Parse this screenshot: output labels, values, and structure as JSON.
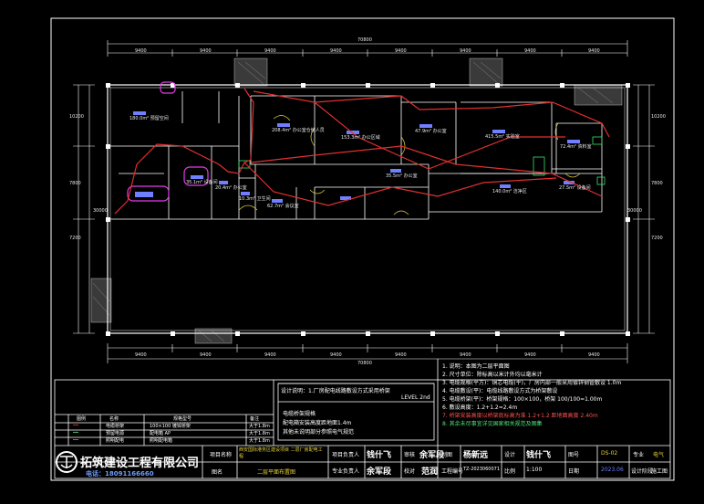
{
  "company": {
    "name": "拓筑建设工程有限公司",
    "phone": "电话：18091166660"
  },
  "dimensions": {
    "overall": "70800",
    "top_segments": [
      "9400",
      "9400",
      "9400",
      "9400",
      "9400",
      "9400",
      "9400",
      "9400"
    ],
    "left_side": [
      "10200",
      "7800",
      "7200",
      "30000"
    ],
    "right_side": [
      "10200",
      "7800",
      "7200",
      "30000"
    ]
  },
  "rooms": [
    {
      "label": "180.0m² 预留空间"
    },
    {
      "label": "208.4m² 办公室仓储人员"
    },
    {
      "label": "153.3m² 办公区域"
    },
    {
      "label": "415.5m² 实验室"
    },
    {
      "label": "47.9m² 办公室"
    },
    {
      "label": "72.4m² 资料室"
    },
    {
      "label": "35.1m² 设备间"
    },
    {
      "label": "20.4m² 办公室"
    },
    {
      "label": "10.3m² 卫生间"
    },
    {
      "label": "62.7m² 会议室"
    },
    {
      "label": "140.0m² 洁净区"
    },
    {
      "label": "27.5m² 设备间"
    },
    {
      "label": "35.5m² 办公室"
    }
  ],
  "notes": [
    "1. 说明：本图为二层平面图",
    "2. 尺寸单位：除标高以米计外均以毫米计",
    "3. 电缆规格(平方)：铜芯电缆(平)，厂房内部一般采用镀锌钢管敷设 1.0m",
    "4. 电缆敷设(平)：电缆线路敷设方式为桥架敷设",
    "5. 电缆桥架(平)：桥架规格：100×100，桥架 100/100=1.00m",
    "6. 敷设高度：1.2+1.2=2.4m",
    "7. 桥架安装高度以桥架底标高为准 1.2+1.2 距地面高度 2.40m",
    "8. 其余未尽事宜详见国家相关规范及图集"
  ],
  "legend": {
    "header": [
      "图例",
      "名称",
      "规格型号",
      "备注"
    ],
    "rows": [
      [
        "━━",
        "电缆桥架",
        "100×100 镀锌桥架",
        "大于1.8m"
      ],
      [
        "━━",
        "预留电源",
        "配电箱 AP",
        "大于1.8m"
      ],
      [
        "━━",
        "照明配电",
        "照明配电箱",
        "大于1.8m"
      ]
    ]
  },
  "design_note": {
    "title": "设计说明：1.厂房配电线路敷设方式采用桥架",
    "lines": [
      "电缆桥架规格",
      "配电箱安装高度距地面1.4m",
      "其他未说明部分参照电气规范"
    ],
    "right": "LEVEL 2nd"
  },
  "title_block": {
    "project_label": "项目名称",
    "project_name": "西安国际港务区建设项目 二层厂房配电工程",
    "drawing_label": "图名",
    "drawing_name": "二层平面布置图",
    "designer_label": "项目负责人",
    "designer_sig": "钱什飞",
    "checker_label": "审核",
    "checker_sig": "余军段",
    "reviewer_label": "专业负责人",
    "reviewer_sig": "余军段",
    "approver_label": "校对",
    "approver_sig": "范润",
    "draw_label": "制图",
    "draw_sig": "杨新远",
    "design_label": "设计",
    "design_sig": "钱什飞",
    "number_label": "图号",
    "number_value": "DS-02",
    "scale_label": "比例",
    "scale_value": "1:100",
    "date_label": "日期",
    "date_value": "2023.06",
    "stage_label": "专业",
    "stage_value": "电气",
    "phase_label": "设计阶段",
    "phase_value": "施工图",
    "code_label": "工程编号",
    "code_value": "TZ-2023060071"
  }
}
